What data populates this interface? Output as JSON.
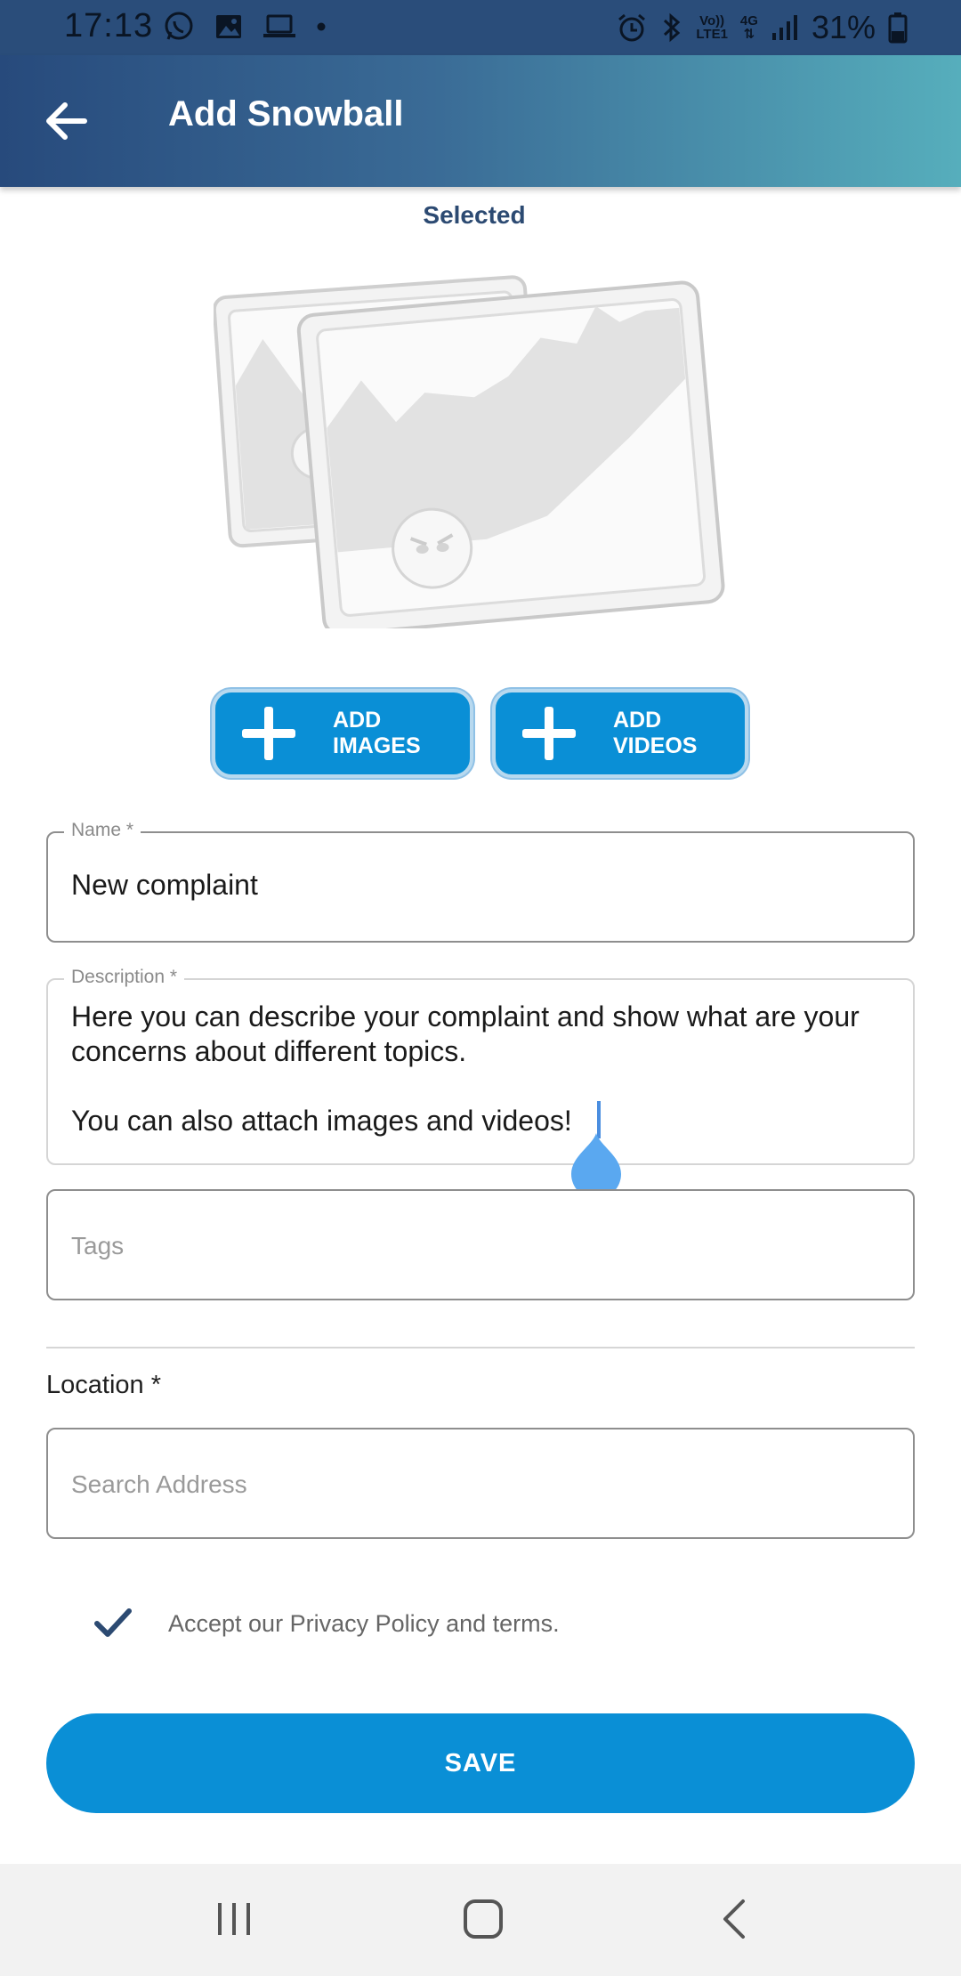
{
  "status_bar": {
    "time": "17:13",
    "left_icons": [
      "whatsapp-icon",
      "gallery-icon",
      "laptop-icon",
      "dot-icon"
    ],
    "right_icons": [
      "alarm-icon",
      "bluetooth-icon",
      "volte-icon",
      "4g-icon",
      "signal-icon",
      "battery-icon"
    ],
    "volte_line1": "Vo))",
    "volte_line2": "LTE1",
    "net_label": "4G",
    "battery": "31%"
  },
  "app_bar": {
    "title": "Add Snowball",
    "back_icon": "arrow-left-icon"
  },
  "media": {
    "selected_label": "Selected",
    "add_images_label": "ADD\nIMAGES",
    "add_videos_label": "ADD\nVIDEOS"
  },
  "form": {
    "name": {
      "label": "Name *",
      "value": "New complaint"
    },
    "description": {
      "label": "Description *",
      "value": "Here you can describe your complaint and show what are your concerns about different topics.\n\nYou can also attach images and videos!"
    },
    "tags": {
      "placeholder": "Tags"
    },
    "location": {
      "label": "Location *",
      "placeholder": "Search Address"
    },
    "privacy": {
      "checked": true,
      "text": "Accept our Privacy Policy and terms."
    },
    "save_label": "SAVE"
  },
  "nav_bar": {
    "icons": [
      "recent-apps-icon",
      "home-icon",
      "back-icon"
    ]
  },
  "colors": {
    "accent": "#0a8fd6",
    "title_dark": "#2c4a72",
    "appbar_start": "#274a7c",
    "appbar_end": "#56aebc"
  }
}
